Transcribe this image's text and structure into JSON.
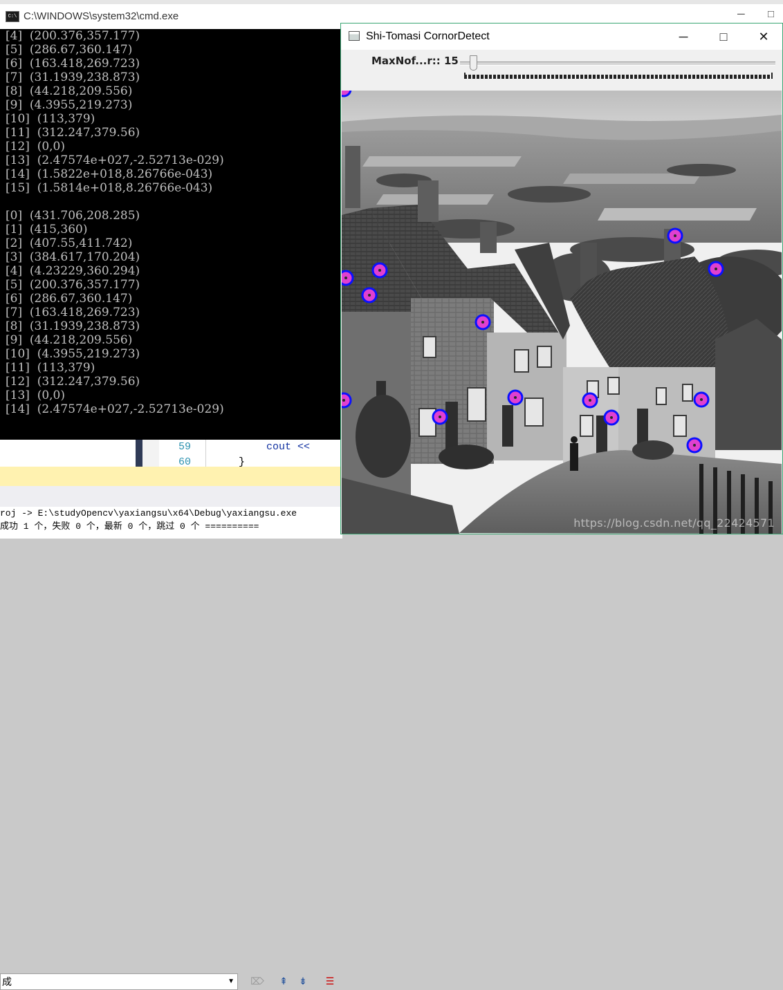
{
  "console": {
    "title": "C:\\WINDOWS\\system32\\cmd.exe",
    "icon_text": "C:\\",
    "controls": {
      "minimize": "─",
      "close": "□"
    },
    "lines": [
      "[4]  (200.376,357.177)",
      "[5]  (286.67,360.147)",
      "[6]  (163.418,269.723)",
      "[7]  (31.1939,238.873)",
      "[8]  (44.218,209.556)",
      "[9]  (4.3955,219.273)",
      "[10]  (113,379)",
      "[11]  (312.247,379.56)",
      "[12]  (0,0)",
      "[13]  (2.47574e+027,-2.52713e-029)",
      "[14]  (1.5822e+018,8.26766e-043)",
      "[15]  (1.5814e+018,8.26766e-043)",
      "",
      "[0]  (431.706,208.285)",
      "[1]  (415,360)",
      "[2]  (407.55,411.742)",
      "[3]  (384.617,170.204)",
      "[4]  (4.23229,360.294)",
      "[5]  (200.376,357.177)",
      "[6]  (286.67,360.147)",
      "[7]  (163.418,269.723)",
      "[8]  (31.1939,238.873)",
      "[9]  (44.218,209.556)",
      "[10]  (4.3955,219.273)",
      "[11]  (113,379)",
      "[12]  (312.247,379.56)",
      "[13]  (0,0)",
      "[14]  (2.47574e+027,-2.52713e-029)"
    ]
  },
  "editor": {
    "line_numbers": [
      "59",
      "60"
    ],
    "code_line": "cout <<",
    "code_line2": "}"
  },
  "output_panel": {
    "source_select": "成",
    "lines": [
      "roj -> E:\\studyOpencv\\yaxiangsu\\x64\\Debug\\yaxiangsu.exe",
      "成功 1 个，失败 0 个，最新 0 个，跳过 0 个 =========="
    ]
  },
  "image_window": {
    "title": "Shi-Tomasi CornorDetect",
    "controls": {
      "minimize": "─",
      "maximize": "□",
      "close": "✕"
    },
    "trackbar": {
      "label": "MaxNof...r:: 15",
      "value": 15,
      "max": 500
    },
    "watermark": "https://blog.csdn.net/qq_22424571",
    "marker_color": "#0a10ff",
    "marker_fill": "#e040d0"
  }
}
